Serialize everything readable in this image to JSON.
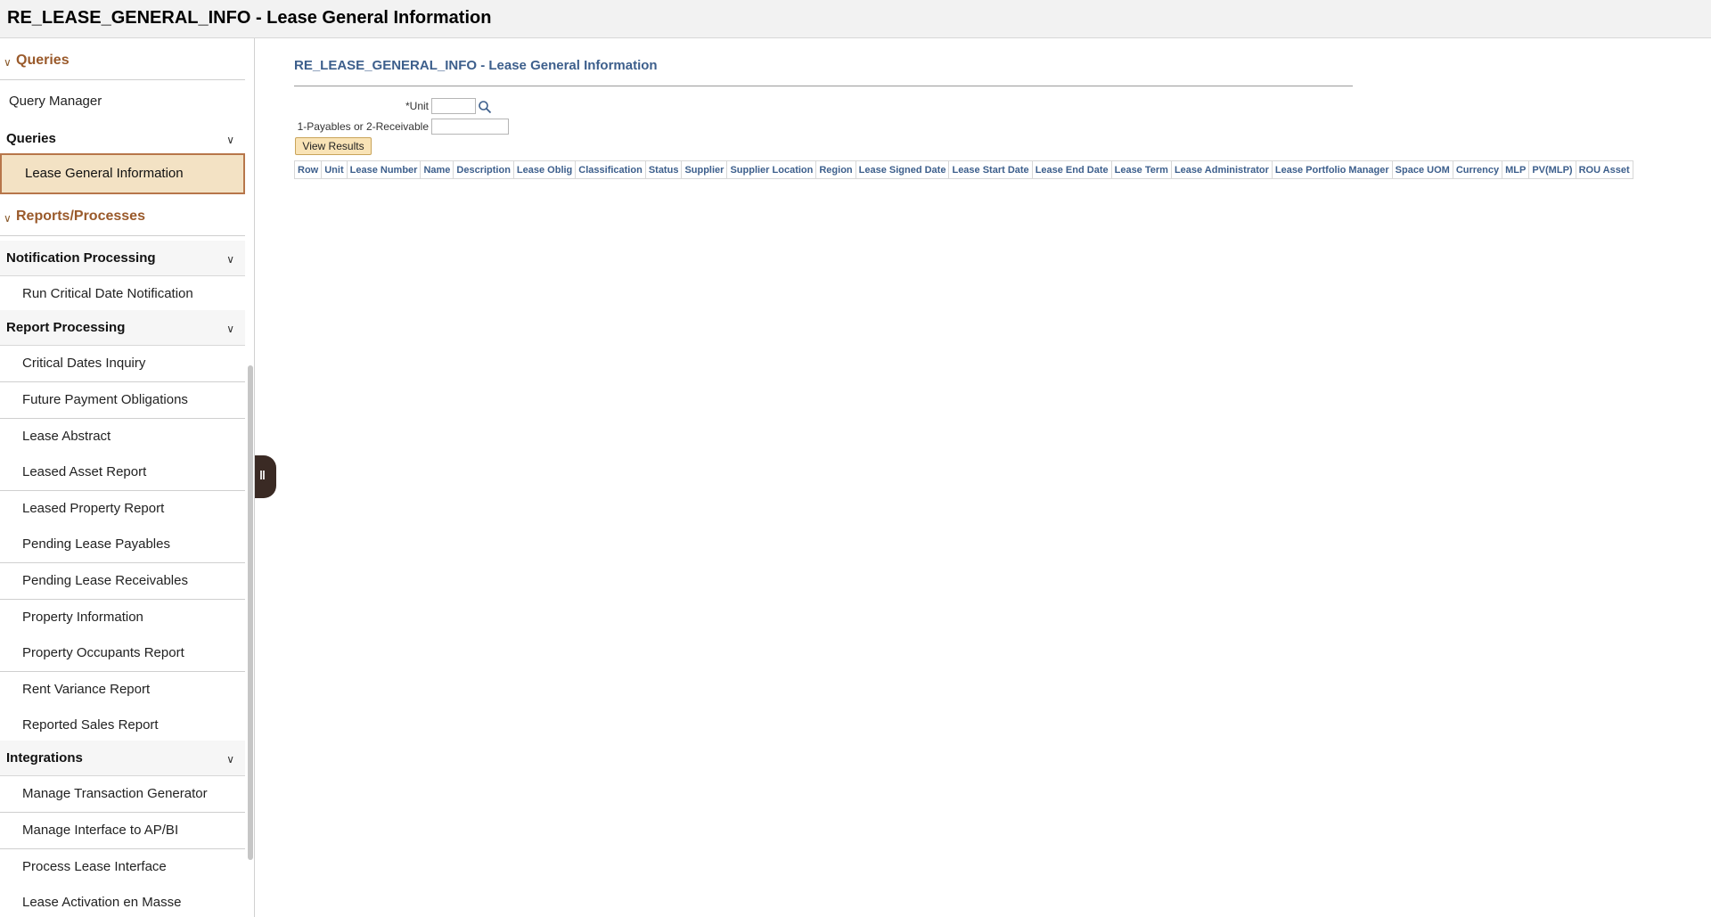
{
  "window": {
    "title": "RE_LEASE_GENERAL_INFO - Lease General Information"
  },
  "sidebar": {
    "queries_section": "Queries",
    "query_manager": "Query Manager",
    "queries_group": "Queries",
    "selected_item": "Lease General Information",
    "reports_section": "Reports/Processes",
    "notification_group": "Notification Processing",
    "notification_items": [
      "Run Critical Date Notification"
    ],
    "report_group": "Report Processing",
    "report_items": [
      "Critical Dates Inquiry",
      "Future Payment Obligations",
      "Lease Abstract",
      "Leased Asset Report",
      "Leased Property Report",
      "Pending Lease Payables",
      "Pending Lease Receivables",
      "Property Information",
      "Property Occupants Report",
      "Rent Variance Report",
      "Reported Sales Report"
    ],
    "integrations_group": "Integrations",
    "integration_items": [
      "Manage Transaction Generator",
      "Manage Interface to AP/BI",
      "Process Lease Interface",
      "Lease Activation en Masse"
    ],
    "collapse_icon": "pause-bars-icon"
  },
  "main": {
    "page_title": "RE_LEASE_GENERAL_INFO - Lease General Information",
    "unit_label": "*Unit",
    "unit_value": "",
    "payables_label": "1-Payables or 2-Receivable",
    "payables_value": "",
    "view_results": "View Results",
    "columns": [
      "Row",
      "Unit",
      "Lease Number",
      "Name",
      "Description",
      "Lease Oblig",
      "Classification",
      "Status",
      "Supplier",
      "Supplier Location",
      "Region",
      "Lease Signed Date",
      "Lease Start Date",
      "Lease End Date",
      "Lease Term",
      "Lease Administrator",
      "Lease Portfolio Manager",
      "Space UOM",
      "Currency",
      "MLP",
      "PV(MLP)",
      "ROU Asset"
    ]
  },
  "colors": {
    "section_brown": "#9a5a2b",
    "title_blue": "#3d5f8c",
    "selected_bg": "#f3e2c4",
    "button_bg": "#f9e3b6"
  }
}
